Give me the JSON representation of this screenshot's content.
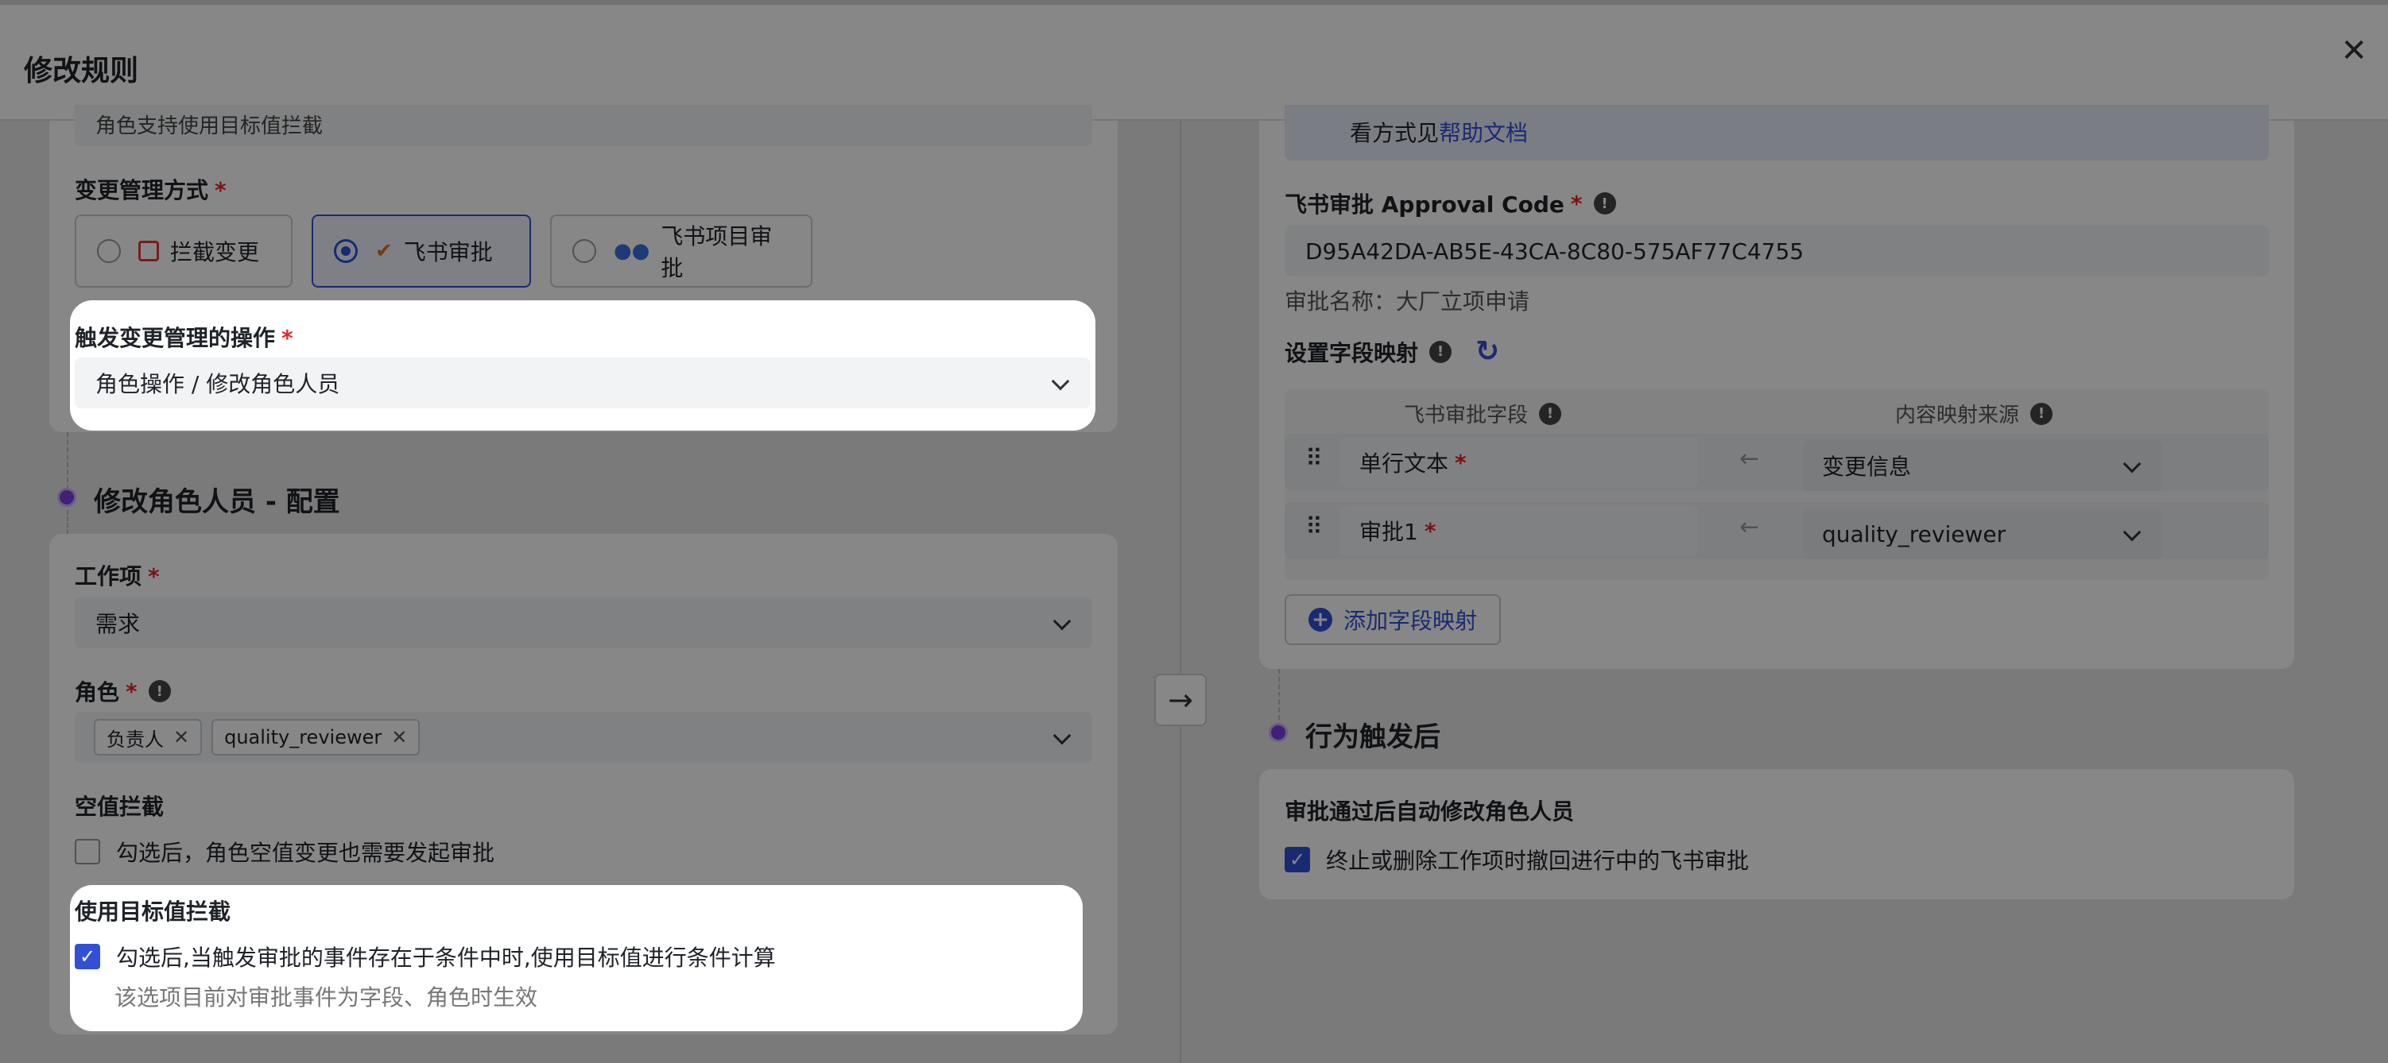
{
  "header": {
    "title": "修改规则",
    "close_symbol": "✕"
  },
  "left": {
    "truncated_top_text": "角色支持使用目标值拦截",
    "change_mgmt": {
      "label": "变更管理方式",
      "options": [
        {
          "label": "拦截变更",
          "icon": "intercept-icon",
          "selected": false
        },
        {
          "label": "飞书审批",
          "icon": "feishu-approval-icon",
          "selected": true
        },
        {
          "label": "飞书项目审批",
          "icon": "feishu-project-icon",
          "selected": false
        }
      ]
    },
    "trigger": {
      "label": "触发变更管理的操作",
      "value": "角色操作 / 修改角色人员"
    },
    "config_section": "修改角色人员 - 配置",
    "work_item": {
      "label": "工作项",
      "value": "需求"
    },
    "role": {
      "label": "角色",
      "tags": [
        "负责人",
        "quality_reviewer"
      ]
    },
    "null_intercept": {
      "label": "空值拦截",
      "checkbox_label": "勾选后，角色空值变更也需要发起审批",
      "checked": false
    },
    "target_intercept": {
      "label": "使用目标值拦截",
      "checkbox_label": "勾选后,当触发审批的事件存在于条件中时,使用目标值进行条件计算",
      "hint": "该选项目前对审批事件为字段、角色时生效",
      "checked": true
    }
  },
  "right": {
    "help_prefix": "看方式见",
    "help_link": "帮助文档",
    "approval_code": {
      "label": "飞书审批 Approval Code",
      "value": "D95A42DA-AB5E-43CA-8C80-575AF77C4755"
    },
    "approval_name": "审批名称：大厂立项申请",
    "field_mapping": {
      "label": "设置字段映射",
      "col_field": "飞书审批字段",
      "col_source": "内容映射来源",
      "rows": [
        {
          "field": "单行文本",
          "source": "变更信息"
        },
        {
          "field": "审批1",
          "source": "quality_reviewer"
        }
      ],
      "add_label": "添加字段映射"
    },
    "after_section": "行为触发后",
    "after": {
      "label": "审批通过后自动修改角色人员",
      "checkbox_label": "终止或删除工作项时撤回进行中的飞书审批",
      "checked": true
    }
  },
  "arrow_symbol": "→",
  "colors": {
    "accent": "#3250d6",
    "required": "#e22222",
    "dot": "#7a3fe0"
  }
}
